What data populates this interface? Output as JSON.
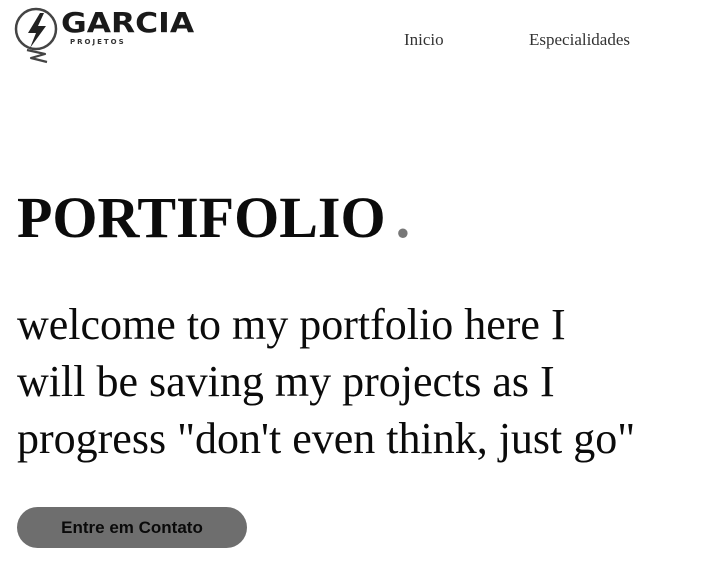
{
  "brand": {
    "name": "GARCIA",
    "subtitle": "PROJETOS",
    "icon": "lightning-bolt-icon"
  },
  "nav": {
    "items": [
      {
        "label": "Inicio"
      },
      {
        "label": "Especialidades"
      }
    ]
  },
  "hero": {
    "title": "PORTIFOLIO",
    "title_dot": ".",
    "intro_lines": [
      "welcome to my portfolio here I",
      "will be saving my projects as I",
      "progress \"don't even think, just go\""
    ],
    "cta_label": "Entre em Contato"
  },
  "colors": {
    "text": "#0b0b0b",
    "dot": "#777777",
    "button_bg": "#6e6e6e",
    "nav_text": "#333333"
  }
}
